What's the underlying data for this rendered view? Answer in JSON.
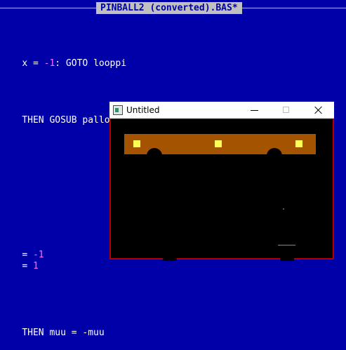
{
  "editor": {
    "document_title": "PINBALL2 (converted).BAS*",
    "background_color": "#0000a8",
    "code_lines": [
      {
        "parts": [
          {
            "text": "x = ",
            "style": "kw"
          },
          {
            "text": "-1",
            "style": "num"
          },
          {
            "text": ": GOTO looppi",
            "style": "kw"
          }
        ]
      },
      {
        "parts": [
          {
            "text": "THEN GOSUB pallo",
            "style": "kw"
          }
        ]
      },
      {
        "parts": [
          {
            "text": "= ",
            "style": "kw"
          },
          {
            "text": "-1",
            "style": "num"
          }
        ]
      },
      {
        "parts": [
          {
            "text": "= ",
            "style": "kw"
          },
          {
            "text": "1",
            "style": "num"
          }
        ]
      },
      {
        "parts": [
          {
            "text": "THEN muu = -muu",
            "style": "kw"
          }
        ]
      }
    ]
  },
  "window": {
    "title": "Untitled",
    "icon": "app-window-icon",
    "controls": [
      "minimize-icon",
      "maximize-icon",
      "close-icon"
    ],
    "game": {
      "background_color": "#000000",
      "border_color": "#b00000",
      "bar_color": "#a45400",
      "lamp_color": "#ffff54",
      "lamp_count": 3,
      "bumper_count": 2,
      "flipper_color": "#ff5555"
    }
  }
}
